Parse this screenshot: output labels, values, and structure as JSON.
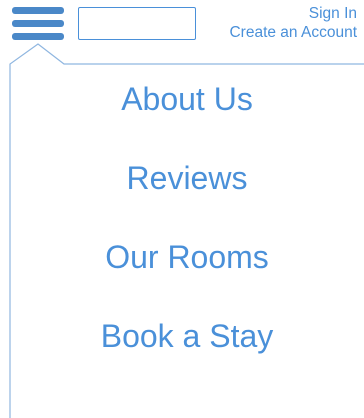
{
  "header": {
    "search_placeholder": "",
    "search_value": "",
    "sign_in_label": "Sign In",
    "create_account_label": "Create an Account"
  },
  "menu": {
    "items": [
      {
        "label": "About Us"
      },
      {
        "label": "Reviews"
      },
      {
        "label": "Our Rooms"
      },
      {
        "label": "Book a Stay"
      }
    ]
  },
  "icons": {
    "menu": "hamburger-menu-icon"
  },
  "colors": {
    "accent": "#4a90d9",
    "icon": "#4a88c8",
    "outline": "#8fb6e0",
    "background": "#ffffff"
  }
}
